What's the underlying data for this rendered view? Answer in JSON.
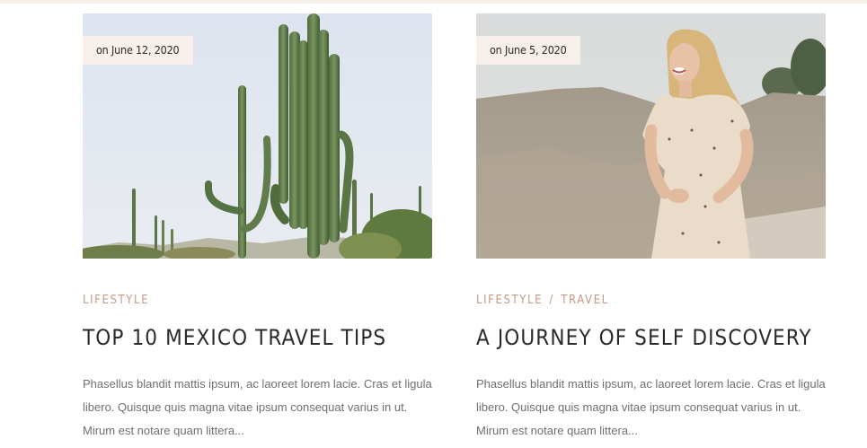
{
  "posts": [
    {
      "date": "on June 12, 2020",
      "categories": [
        "LIFESTYLE"
      ],
      "title": "TOP 10 MEXICO TRAVEL TIPS",
      "excerpt": "Phasellus blandit mattis ipsum, ac laoreet lorem lacie. Cras et ligula libero. Quisque quis magna vitae ipsum consequat varius in ut. Mirum est notare quam littera..."
    },
    {
      "date": "on June 5, 2020",
      "categories": [
        "LIFESTYLE",
        "TRAVEL"
      ],
      "category_separator": "/",
      "title": "A JOURNEY OF SELF DISCOVERY",
      "excerpt": "Phasellus blandit mattis ipsum, ac laoreet lorem lacie. Cras et ligula libero. Quisque quis magna vitae ipsum consequat varius in ut. Mirum est notare quam littera..."
    }
  ],
  "colors": {
    "badge_bg": "#f6efea",
    "category": "#c49b86",
    "title": "#2a2a2a",
    "excerpt": "#6f6f6f"
  }
}
